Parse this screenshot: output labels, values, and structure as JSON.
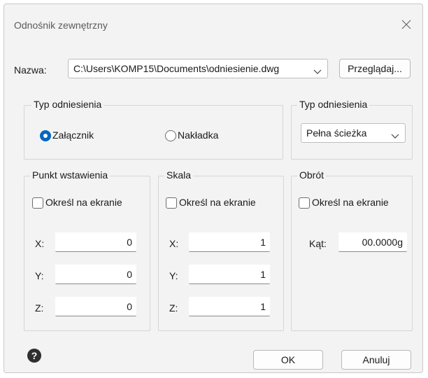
{
  "window": {
    "title": "Odnośnik zewnętrzny",
    "close_icon": "close-icon"
  },
  "name_row": {
    "label": "Nazwa:",
    "path": "C:\\Users\\KOMP15\\Documents\\odniesienie.dwg",
    "browse_label": "Przeglądaj..."
  },
  "reference_type_group": {
    "legend": "Typ odniesienia",
    "options": [
      {
        "label": "Załącznik",
        "selected": true
      },
      {
        "label": "Nakładka",
        "selected": false
      }
    ]
  },
  "path_type_group": {
    "legend": "Typ odniesienia",
    "selected": "Pełna ścieżka"
  },
  "insertion_point_group": {
    "legend": "Punkt wstawienia",
    "specify_on_screen": "Określ na ekranie",
    "x_label": "X:",
    "x": "0",
    "y_label": "Y:",
    "y": "0",
    "z_label": "Z:",
    "z": "0"
  },
  "scale_group": {
    "legend": "Skala",
    "specify_on_screen": "Określ na ekranie",
    "x_label": "X:",
    "x": "1",
    "y_label": "Y:",
    "y": "1",
    "z_label": "Z:",
    "z": "1"
  },
  "rotation_group": {
    "legend": "Obrót",
    "specify_on_screen": "Określ na ekranie",
    "angle_label": "Kąt:",
    "angle": "00.0000g"
  },
  "footer": {
    "help_glyph": "?",
    "ok_label": "OK",
    "cancel_label": "Anuluj"
  },
  "colors": {
    "accent": "#0067c0",
    "dialog_bg": "#f3f3f3"
  }
}
